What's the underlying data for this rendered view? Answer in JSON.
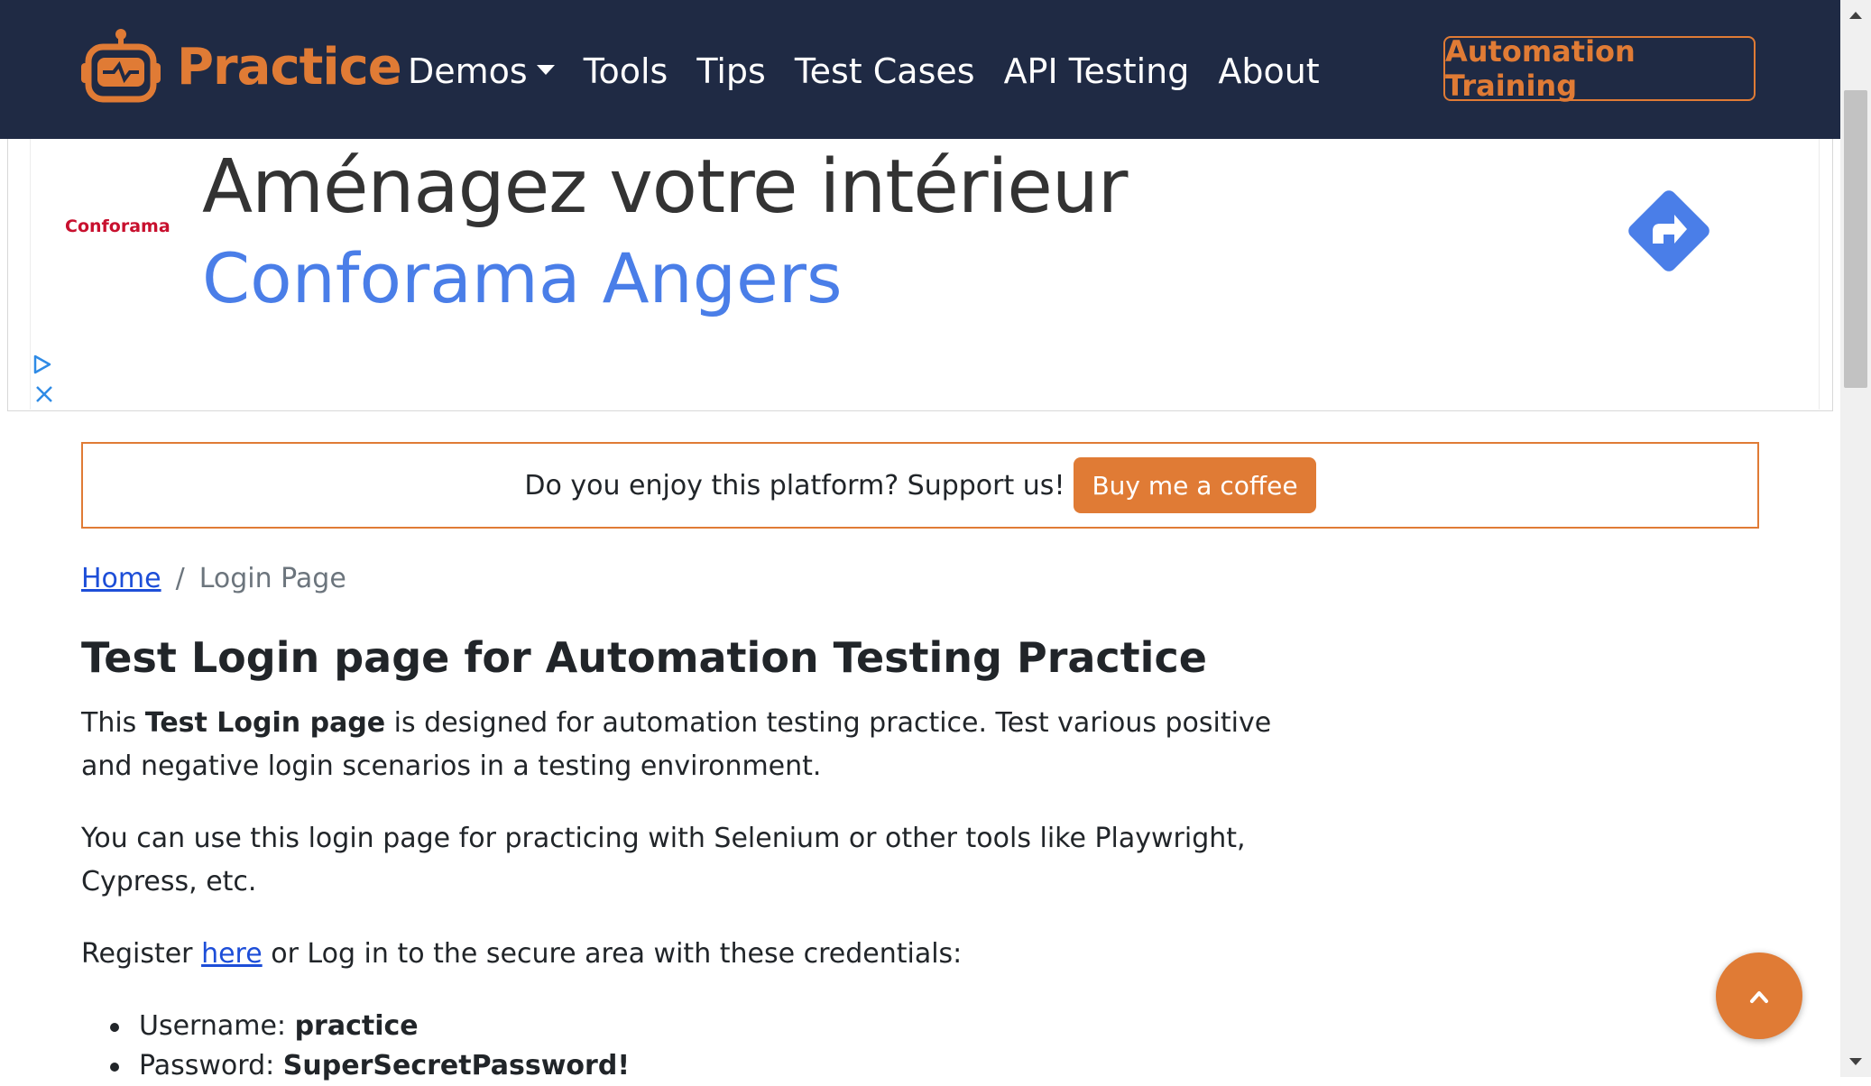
{
  "navbar": {
    "brand": "Practice",
    "links": [
      "Demos",
      "Tools",
      "Tips",
      "Test Cases",
      "API Testing",
      "About"
    ],
    "cta": "Automation Training"
  },
  "ad": {
    "advertiser": "Conforama",
    "headline": "Aménagez votre intérieur",
    "subline": "Conforama Angers"
  },
  "support": {
    "text": "Do you enjoy this platform? Support us!",
    "button": "Buy me a coffee"
  },
  "breadcrumb": {
    "home": "Home",
    "separator": "/",
    "current": "Login Page"
  },
  "content": {
    "title": "Test Login page for Automation Testing Practice",
    "p1_prefix": "This ",
    "p1_bold": "Test Login page",
    "p1_suffix": " is designed for automation testing practice. Test various positive and negative login scenarios in a testing environment.",
    "p2": "You can use this login page for practicing with Selenium or other tools like Playwright, Cypress, etc.",
    "p3_prefix": "Register ",
    "p3_link": "here",
    "p3_suffix": " or Log in to the secure area with these credentials:",
    "credentials": [
      {
        "label": "Username: ",
        "value": "practice"
      },
      {
        "label": "Password: ",
        "value": "SuperSecretPassword!"
      }
    ]
  },
  "colors": {
    "navbar_bg": "#1f2a44",
    "accent": "#e07b35",
    "link": "#1d4ed8",
    "ad_blue": "#4a7ee8"
  },
  "icons": {
    "brand": "robot-logo-icon",
    "nav_dropdown": "caret-down-icon",
    "ad_action": "directions-arrow-icon",
    "ad_choices": "adchoices-icon",
    "ad_close": "close-icon",
    "scroll_top": "chevron-up-icon"
  }
}
